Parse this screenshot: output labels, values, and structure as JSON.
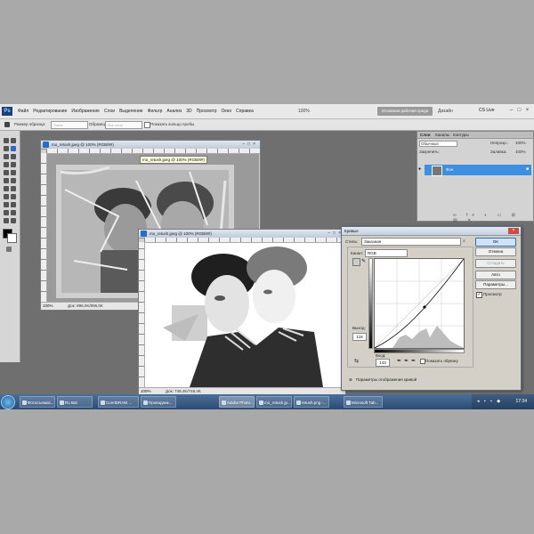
{
  "menubar": {
    "app_logo": "Ps",
    "items": [
      "Файл",
      "Редактирование",
      "Изображение",
      "Слои",
      "Выделение",
      "Фильтр",
      "Анализ",
      "3D",
      "Просмотр",
      "Окно",
      "Справка"
    ],
    "zoom": "100%",
    "workspace_button": "Основная рабочая среда",
    "design_label": "Дизайн",
    "cs_live": "CS Live"
  },
  "options_bar": {
    "sample_size_label": "Размер образца:",
    "sample_size_value": "Точка",
    "sample_label": "Образец:",
    "sample_value": "Все слои",
    "show_ring_label": "Показать кольцо пробы"
  },
  "document_back": {
    "title": "mo_retush.jpeg @ 100% (RGB/8#)",
    "zoom": "100%",
    "doc_info": "Док: 896,0K/896,0K"
  },
  "document_front": {
    "title": "mo_retush.jpeg @ 100% (RGB/8#)",
    "zoom": "100%",
    "doc_info": "Док: 748,4K/748,4K"
  },
  "tooltip": "mo_retush.jpeg @ 100% (RGB/8#)",
  "layers_panel": {
    "tabs": [
      "Слои",
      "Каналы",
      "Контуры"
    ],
    "blend_mode": "Обычные",
    "opacity_label": "Непрозр.:",
    "opacity_value": "100%",
    "lock_label": "Закрепить:",
    "fill_label": "Заливка:",
    "fill_value": "100%",
    "layer_name": "Фон"
  },
  "curves_dialog": {
    "title": "Кривые",
    "preset_label": "Стиль:",
    "preset_value": "Заказная",
    "channel_label": "Канал:",
    "channel_value": "RGB",
    "output_label": "Выход:",
    "output_value": "118",
    "input_label": "Вход:",
    "input_value": "143",
    "show_clipping_label": "Показать обрезку",
    "display_options_label": "Параметры отображения кривой",
    "buttons": {
      "ok": "OK",
      "cancel": "Отмена",
      "smooth": "Сгладить",
      "auto": "Авто",
      "options": "Параметры...",
      "preview": "Просмотр"
    }
  },
  "taskbar": {
    "tasks": [
      "Фотосъемка...",
      "Ru Bat",
      "CorelDRAW ...",
      "Проводник...",
      "Adobe Photo...",
      "mo_retush.jp...",
      "retush.png -...",
      "Microsoft Tab..."
    ],
    "clock": "17:34"
  }
}
